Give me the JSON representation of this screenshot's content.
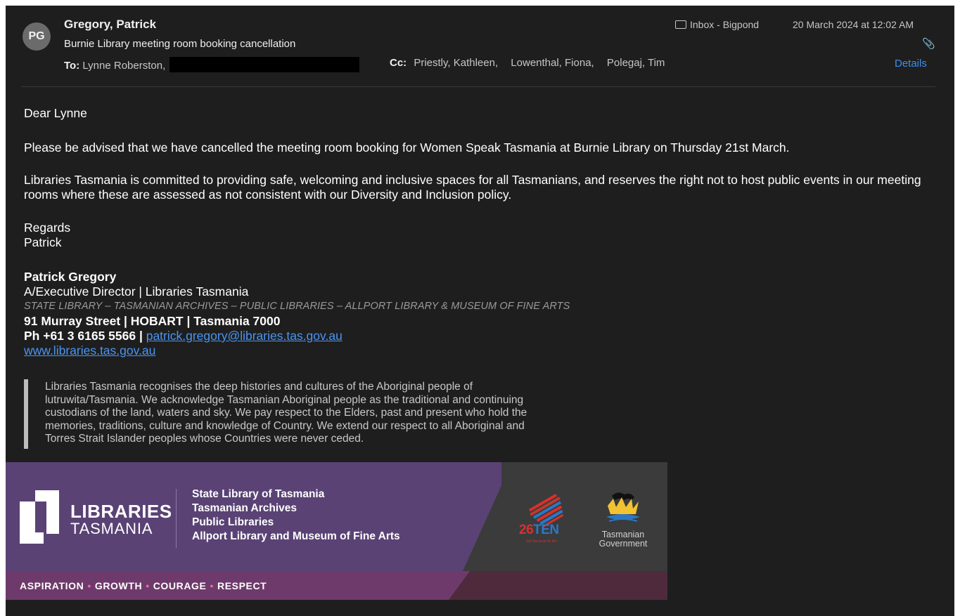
{
  "header": {
    "avatar_initials": "PG",
    "sender": "Gregory, Patrick",
    "subject": "Burnie Library meeting room booking cancellation",
    "to_label": "To:",
    "to": "Lynne Roberston,",
    "cc_label": "Cc:",
    "cc": [
      "Priestly, Kathleen,",
      "Lowenthal, Fiona,",
      "Polegaj, Tim"
    ],
    "mailbox": "Inbox - Bigpond",
    "date": "20 March 2024 at 12:02 AM",
    "details_label": "Details"
  },
  "body": {
    "greeting": "Dear Lynne",
    "para1": "Please be advised that we have cancelled the meeting room booking for Women Speak Tasmania at Burnie Library on Thursday 21st March.",
    "para2": "Libraries Tasmania is committed to providing safe, welcoming and inclusive spaces for all Tasmanians, and reserves the right not to host public events in our meeting rooms where these are assessed as not consistent with our Diversity and Inclusion policy.",
    "regards": "Regards",
    "signoff": "Patrick"
  },
  "signature": {
    "name": "Patrick Gregory",
    "title": "A/Executive Director | Libraries Tasmania",
    "orgs_line": "STATE LIBRARY – TASMANIAN ARCHIVES – PUBLIC LIBRARIES – ALLPORT LIBRARY & MUSEUM OF FINE ARTS",
    "address": "91 Murray Street | HOBART | Tasmania 7000",
    "phone_prefix": "Ph +61 3 6165 5566 | ",
    "email": "patrick.gregory@libraries.tas.gov.au",
    "website": "www.libraries.tas.gov.au"
  },
  "acknowledgement": {
    "lines": [
      "Libraries Tasmania recognises the deep histories and cultures of the Aboriginal people of",
      "lutruwita/Tasmania. We acknowledge Tasmanian Aboriginal people as the traditional and continuing",
      "custodians of the land, waters and sky. We pay respect to the Elders, past and present who hold the",
      "memories, traditions, culture and knowledge of Country. We extend our respect to all Aboriginal and",
      "Torres Strait Islander peoples whose Countries were never ceded."
    ]
  },
  "banner": {
    "logo_line1": "LIBRARIES",
    "logo_line2": "TASMANIA",
    "orgs": [
      "State Library of Tasmania",
      "Tasmanian Archives",
      "Public Libraries",
      "Allport Library and Museum of Fine Arts"
    ],
    "values": [
      "ASPIRATION",
      "GROWTH",
      "COURAGE",
      "RESPECT"
    ],
    "ten_left": "26",
    "ten_right": "TEN",
    "ten_tagline": "Get the tools for life",
    "gov_line1": "Tasmanian",
    "gov_line2": "Government"
  },
  "colors": {
    "background": "#1e1e1e",
    "link": "#4a95f2",
    "details": "#3d8ef0",
    "banner_purple": "#5a4275",
    "banner_strip": "#6e3a6b"
  },
  "icons": {
    "mailbox": "folder-icon",
    "attachment": "paperclip-icon"
  }
}
